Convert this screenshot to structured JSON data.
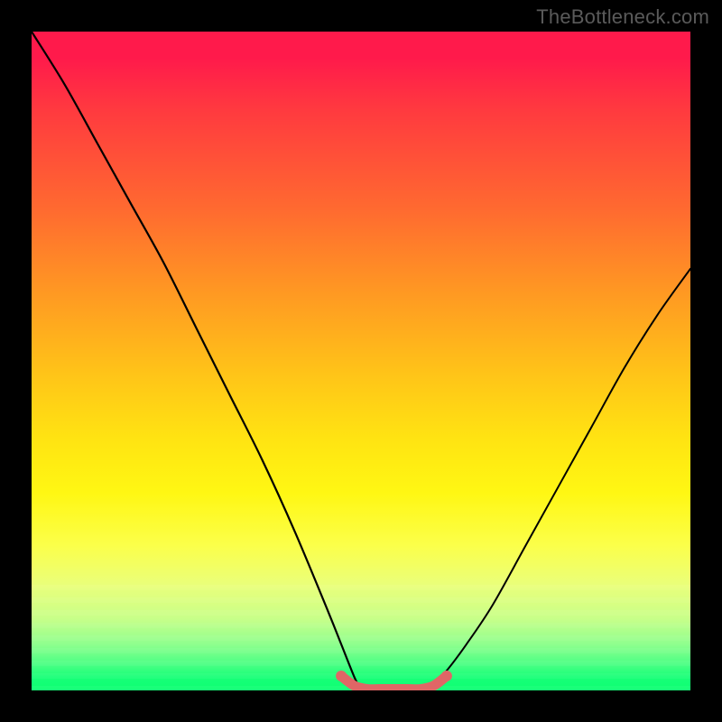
{
  "watermark": "TheBottleneck.com",
  "colors": {
    "frame_bg": "#000000",
    "curve": "#000000",
    "marker_fill": "#e06666",
    "marker_stroke": "#b04444",
    "gradient_top": "#ff1a4b",
    "gradient_bottom": "#0cff72"
  },
  "chart_data": {
    "type": "line",
    "title": "",
    "xlabel": "",
    "ylabel": "",
    "xlim": [
      0,
      100
    ],
    "ylim": [
      0,
      100
    ],
    "grid": false,
    "legend": false,
    "series": [
      {
        "name": "left-branch",
        "x": [
          0,
          5,
          10,
          15,
          20,
          25,
          30,
          35,
          40,
          45,
          47,
          49,
          50
        ],
        "y": [
          100,
          92,
          83,
          74,
          65,
          55,
          45,
          35,
          24,
          12,
          7,
          2,
          0
        ]
      },
      {
        "name": "right-branch",
        "x": [
          60,
          63,
          66,
          70,
          75,
          80,
          85,
          90,
          95,
          100
        ],
        "y": [
          0,
          3,
          7,
          13,
          22,
          31,
          40,
          49,
          57,
          64
        ]
      },
      {
        "name": "valley-floor",
        "x": [
          47,
          49,
          51,
          53,
          55,
          57,
          59,
          61,
          63
        ],
        "y": [
          2,
          0.5,
          0,
          0,
          0,
          0,
          0,
          0.5,
          2
        ]
      }
    ],
    "annotations": [
      {
        "name": "valley-marker",
        "shape": "thick-segment",
        "x_range": [
          47,
          63
        ],
        "y": 1.2,
        "color": "#e06666"
      }
    ]
  }
}
